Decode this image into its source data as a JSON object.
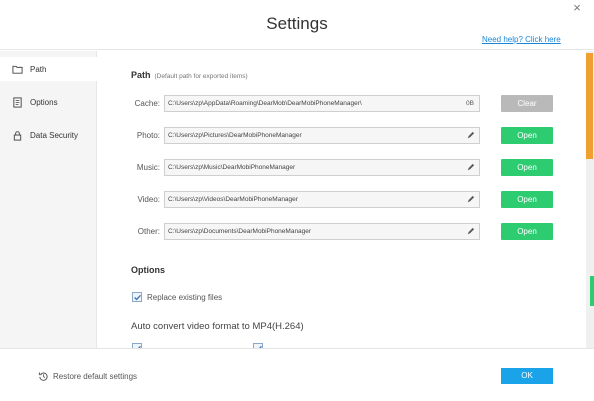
{
  "window": {
    "title": "Settings",
    "close_glyph": "×",
    "help_link": "Need help? Click here"
  },
  "sidebar": {
    "items": [
      {
        "label": "Path",
        "icon": "folder-icon",
        "active": true
      },
      {
        "label": "Options",
        "icon": "options-icon",
        "active": false
      },
      {
        "label": "Data Security",
        "icon": "lock-icon",
        "active": false
      }
    ]
  },
  "path_section": {
    "title": "Path",
    "subtitle": "(Default path for exported items)",
    "rows": [
      {
        "label": "Cache:",
        "value": "C:\\Users\\zp\\AppData\\Roaming\\DearMob\\DearMobiPhoneManager\\",
        "size": "0B",
        "button": "Clear"
      },
      {
        "label": "Photo:",
        "value": "C:\\Users\\zp\\Pictures\\DearMobiPhoneManager",
        "button": "Open"
      },
      {
        "label": "Music:",
        "value": "C:\\Users\\zp\\Music\\DearMobiPhoneManager",
        "button": "Open"
      },
      {
        "label": "Video:",
        "value": "C:\\Users\\zp\\Videos\\DearMobiPhoneManager",
        "button": "Open"
      },
      {
        "label": "Other:",
        "value": "C:\\Users\\zp\\Documents\\DearMobiPhoneManager",
        "button": "Open"
      }
    ]
  },
  "options_section": {
    "title": "Options",
    "replace_label": "Replace existing files",
    "replace_checked": true,
    "convert_title": "Auto convert video format to MP4(H.264)"
  },
  "footer": {
    "restore_label": "Restore default settings",
    "ok_label": "OK"
  },
  "colors": {
    "accent_green": "#2ecc71",
    "ok_blue": "#1aa3e8",
    "link_blue": "#1a86d9",
    "scroll_orange": "#f0a030"
  }
}
